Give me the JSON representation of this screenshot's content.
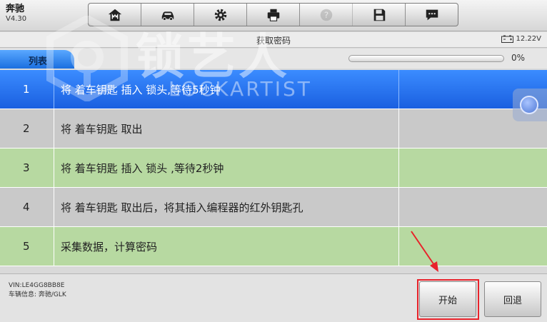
{
  "app": {
    "name": "奔驰",
    "version": "V4.30"
  },
  "toolbar": {
    "items": [
      {
        "icon": "home-icon"
      },
      {
        "icon": "car-icon"
      },
      {
        "icon": "gear-icon"
      },
      {
        "icon": "printer-icon"
      },
      {
        "icon": "help-icon",
        "disabled": true
      },
      {
        "icon": "save-icon"
      },
      {
        "icon": "message-icon"
      }
    ]
  },
  "status": {
    "title": "获取密码",
    "voltage": "12.22V",
    "battery_icon": "battery-icon"
  },
  "list": {
    "tab_label": "列表",
    "progress_percent": 0,
    "progress_label": "0%"
  },
  "steps": [
    {
      "num": "1",
      "text": "将 着车钥匙 插入 锁头,等待5秒钟",
      "state": "selected"
    },
    {
      "num": "2",
      "text": "将 着车钥匙 取出",
      "state": "gray"
    },
    {
      "num": "3",
      "text": "将 着车钥匙 插入 锁头 ,等待2秒钟",
      "state": "green"
    },
    {
      "num": "4",
      "text": "将 着车钥匙 取出后，将其插入编程器的红外钥匙孔",
      "state": "gray"
    },
    {
      "num": "5",
      "text": "采集数据，计算密码",
      "state": "green"
    }
  ],
  "footer": {
    "vin": "VIN:LE4GG8BB8E",
    "vehicle_info": "车辆信息: 奔驰/GLK",
    "start_label": "开始",
    "back_label": "回退"
  },
  "watermark": {
    "text": "锁艺人",
    "subtext": "LOCKARTIST"
  },
  "colors": {
    "selected_row": "#1a6fe0",
    "gray_row": "#c9c9c9",
    "green_row": "#b7d9a1",
    "highlight": "#e8222a"
  }
}
